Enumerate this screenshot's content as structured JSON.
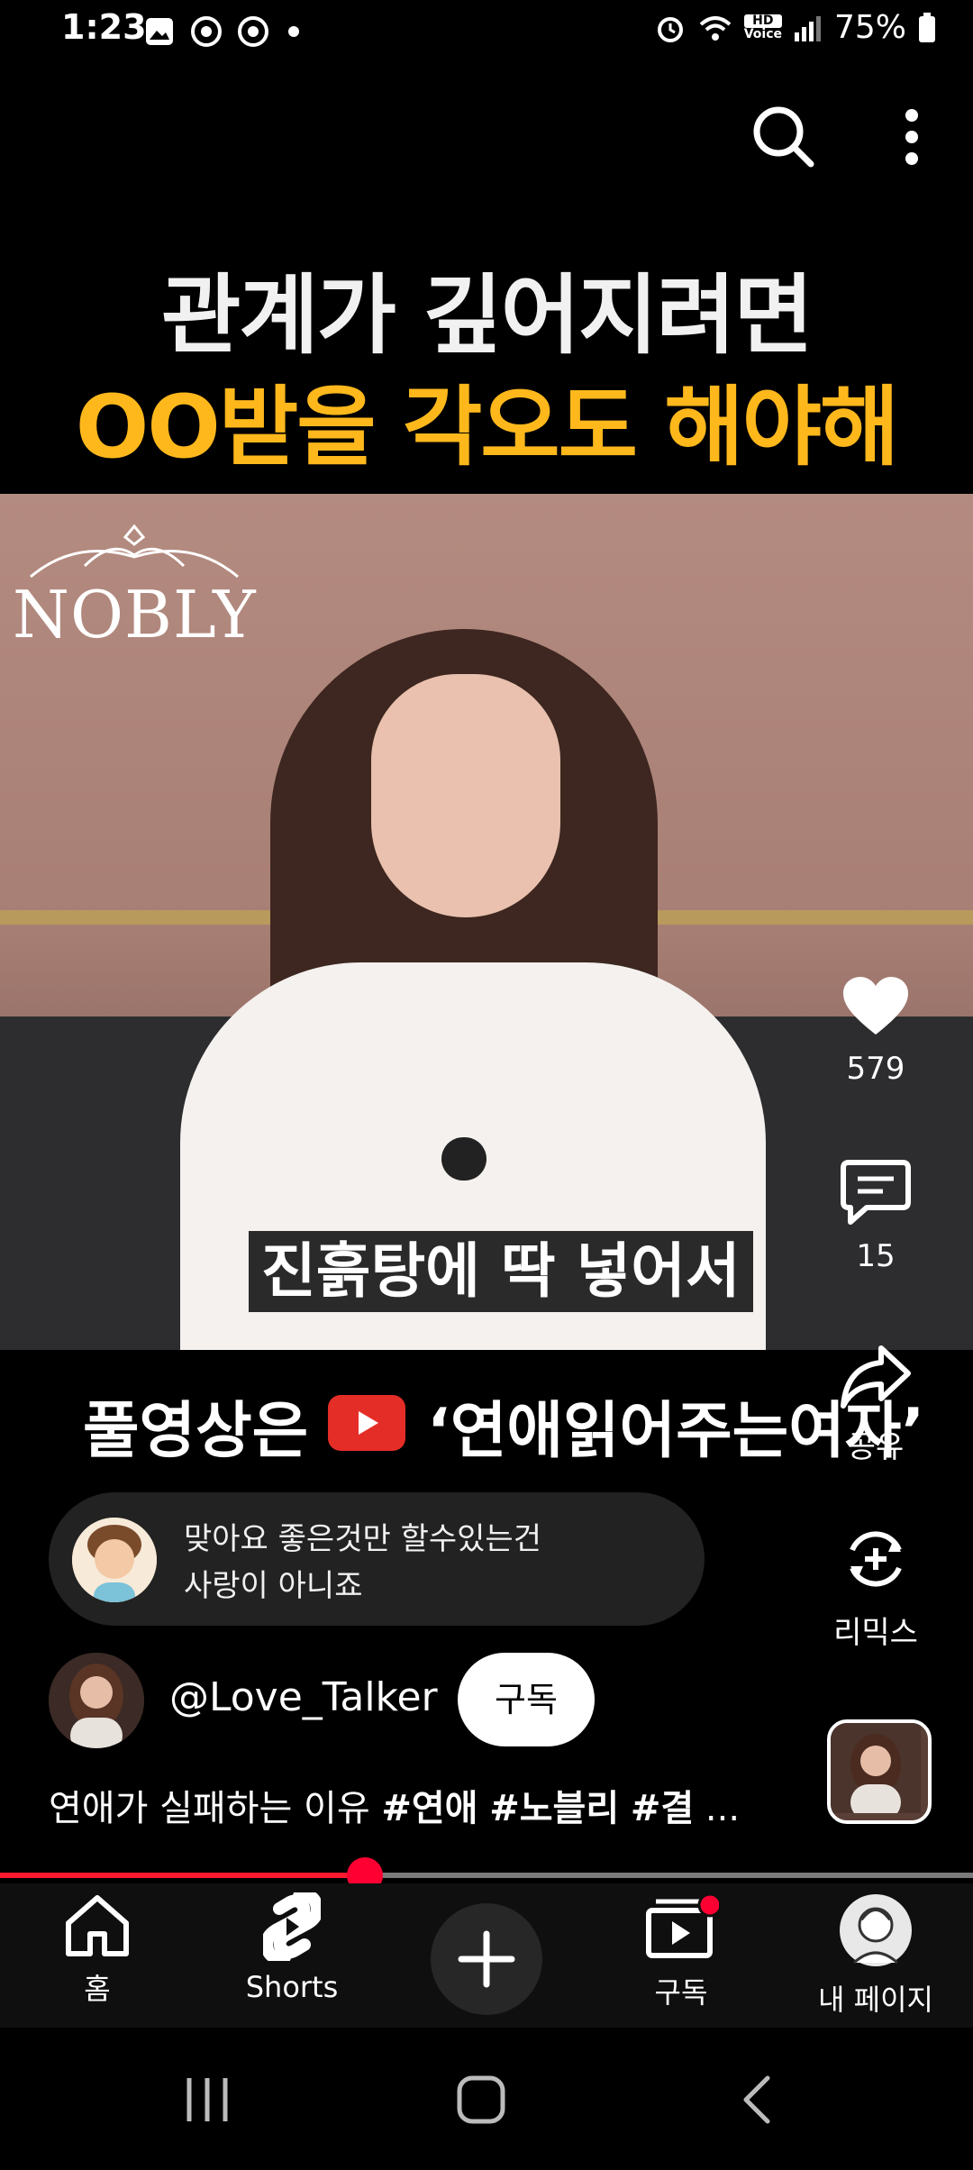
{
  "status_bar": {
    "time": "1:23",
    "battery": "75%",
    "hd_label": "HD",
    "voice_label": "Voice"
  },
  "video": {
    "title_line1": "관계가 깊어지려면",
    "title_line2": "OO받을 각오도 해야해",
    "logo_text": "NOBLY",
    "subtitle": "진흙탕에 딱 넣어서",
    "promo_left": "풀영상은",
    "promo_right": "‘연애읽어주는여자’"
  },
  "actions": {
    "like_count": "579",
    "comment_count": "15",
    "share_label": "공유",
    "remix_label": "리믹스"
  },
  "comment": {
    "line1": "맞아요 좋은것만 할수있는건",
    "line2": "사랑이 아니죠"
  },
  "channel": {
    "handle": "@Love_Talker",
    "subscribe_label": "구독"
  },
  "description": {
    "text": "연애가 실패하는 이유 ",
    "tag1": "#연애",
    "tag2": "#노블리",
    "tag3": "#결",
    "ellipsis": "..."
  },
  "progress": {
    "fraction": 0.375
  },
  "bottom_nav": {
    "home": "홈",
    "shorts": "Shorts",
    "subscriptions": "구독",
    "my_page": "내 페이지"
  },
  "colors": {
    "accent_title": "#ffb81c",
    "youtube_red": "#ff0033"
  }
}
